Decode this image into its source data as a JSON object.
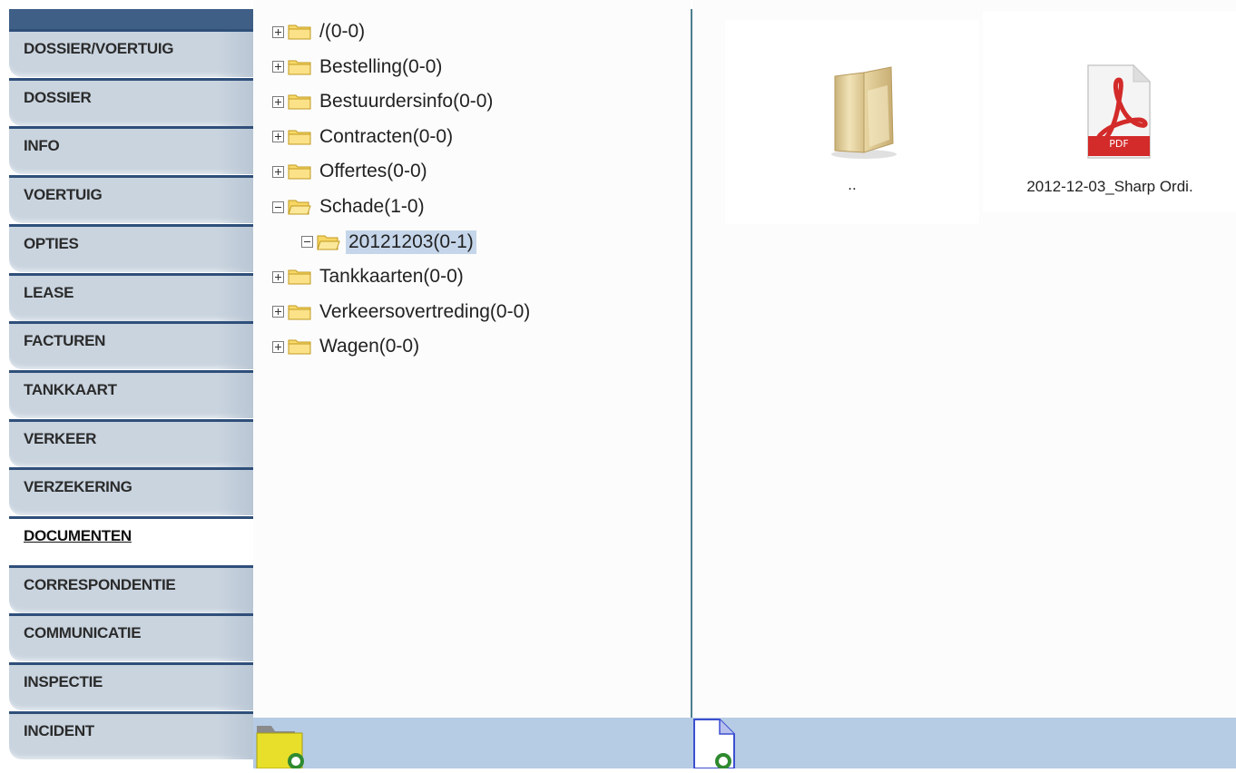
{
  "sidebar": {
    "items": [
      {
        "label": "DOSSIER/VOERTUIG",
        "active": false
      },
      {
        "label": "DOSSIER",
        "active": false
      },
      {
        "label": "INFO",
        "active": false
      },
      {
        "label": "VOERTUIG",
        "active": false
      },
      {
        "label": "OPTIES",
        "active": false
      },
      {
        "label": "LEASE",
        "active": false
      },
      {
        "label": "FACTUREN",
        "active": false
      },
      {
        "label": "TANKKAART",
        "active": false
      },
      {
        "label": "VERKEER",
        "active": false
      },
      {
        "label": "VERZEKERING",
        "active": false
      },
      {
        "label": "DOCUMENTEN",
        "active": true
      },
      {
        "label": "CORRESPONDENTIE",
        "active": false
      },
      {
        "label": "COMMUNICATIE",
        "active": false
      },
      {
        "label": "INSPECTIE",
        "active": false
      },
      {
        "label": "INCIDENT",
        "active": false
      }
    ]
  },
  "tree": {
    "items": [
      {
        "label": "/(0-0)",
        "state": "collapsed",
        "level": 0,
        "selected": false
      },
      {
        "label": "Bestelling(0-0)",
        "state": "collapsed",
        "level": 0,
        "selected": false
      },
      {
        "label": "Bestuurdersinfo(0-0)",
        "state": "collapsed",
        "level": 0,
        "selected": false
      },
      {
        "label": "Contracten(0-0)",
        "state": "collapsed",
        "level": 0,
        "selected": false
      },
      {
        "label": "Offertes(0-0)",
        "state": "collapsed",
        "level": 0,
        "selected": false
      },
      {
        "label": "Schade(1-0)",
        "state": "expanded",
        "level": 0,
        "selected": false
      },
      {
        "label": "20121203(0-1)",
        "state": "expanded",
        "level": 1,
        "selected": true
      },
      {
        "label": "Tankkaarten(0-0)",
        "state": "collapsed",
        "level": 0,
        "selected": false
      },
      {
        "label": "Verkeersovertreding(0-0)",
        "state": "collapsed",
        "level": 0,
        "selected": false
      },
      {
        "label": "Wagen(0-0)",
        "state": "collapsed",
        "level": 0,
        "selected": false
      }
    ]
  },
  "files": {
    "items": [
      {
        "name": "..",
        "icon": "folder-up-icon"
      },
      {
        "name": "2012-12-03_Sharp Ordi.",
        "icon": "pdf-file-icon",
        "badge": "PDF"
      }
    ]
  },
  "toolbar": {
    "new_folder_icon": "new-folder-icon",
    "new_file_icon": "new-file-icon"
  },
  "colors": {
    "sidebar_tab": "#c9d4df",
    "sidebar_border": "#2f4f7a",
    "toolbar_bg": "#b6cbe4",
    "selection": "#c6d6ea",
    "pdf_red": "#d32a2a"
  }
}
